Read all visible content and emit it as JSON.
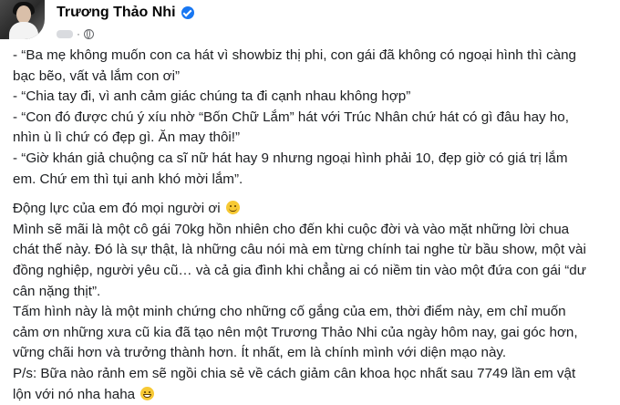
{
  "post": {
    "author_name": "Trương Thảo Nhi",
    "verified_icon": "verified-badge-icon",
    "privacy_icon": "globe-icon",
    "lines": [
      "- “Ba mẹ không muốn con ca hát vì showbiz thị phi, con gái đã không có ngoại hình thì càng",
      "bạc bẽo, vất vả lắm con ơi”",
      "- “Chia tay đi, vì anh cảm giác chúng ta đi cạnh nhau không hợp”",
      "- “Con đó được chú ý xíu nhờ “Bốn Chữ Lắm” hát với Trúc Nhân chứ hát có gì đâu hay ho,",
      "nhìn ù lì chứ có đẹp gì. Ăn may thôi!”",
      "- “Giờ khán giả chuộng ca sĩ nữ hát hay 9 nhưng ngoại hình phải 10, đẹp giờ có giá trị lắm",
      "em. Chứ em thì tụi anh khó mời lắm”.",
      "Động lực của em đó mọi người ơi",
      "Mình sẽ mãi là một cô gái 70kg hồn nhiên cho đến khi cuộc đời và vào mặt những lời chua",
      "chát thế này. Đó là sự thật, là những câu nói mà em từng chính tai nghe từ bầu show, một vài",
      "đồng nghiệp, người yêu cũ… và cả gia đình khi chẳng ai có niềm tin vào một đứa con gái “dư",
      "cân nặng thịt”.",
      "Tấm hình này là một minh chứng cho những cố gắng của em, thời điểm này, em chỉ muốn",
      "cảm ơn những xưa cũ kia đã tạo nên một Trương Thảo Nhi của ngày hôm nay, gai góc hơn,",
      "vững chãi hơn và trưởng thành hơn. Ít nhất, em là chính mình với diện mạo này.",
      "P/s: Bữa nào rảnh em sẽ ngồi chia sẻ về cách giảm cân khoa học nhất sau 7749 lần em vật",
      "lộn với nó nha haha"
    ],
    "emojis": [
      "smiling-face-emoji",
      "grinning-face-emoji"
    ]
  }
}
